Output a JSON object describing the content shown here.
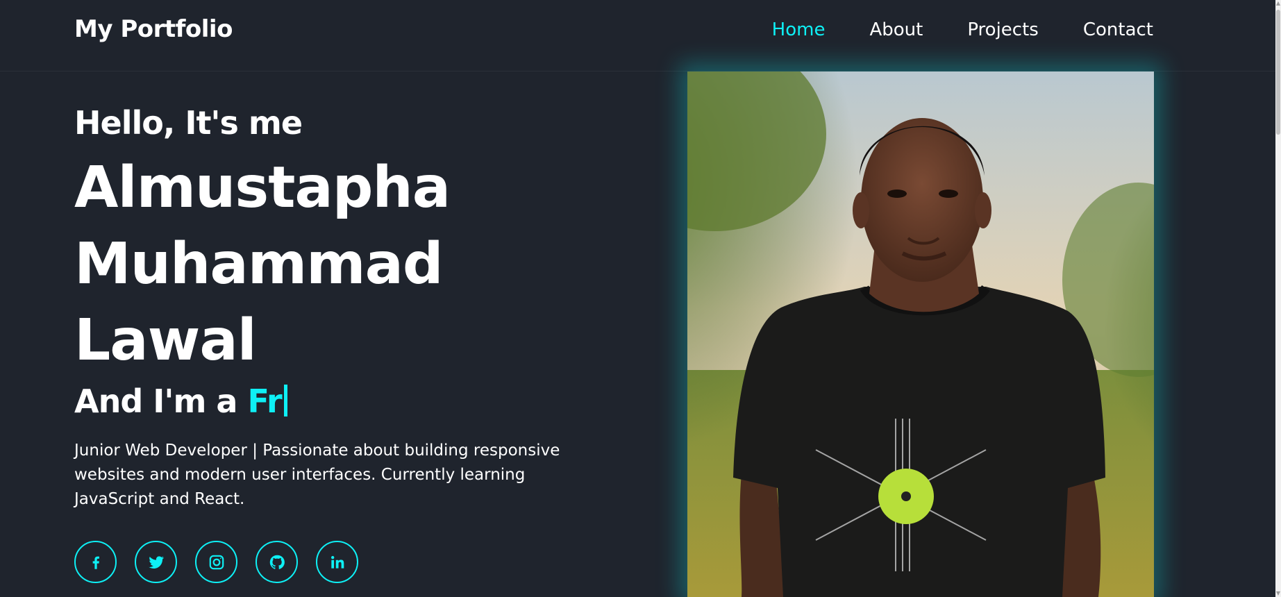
{
  "header": {
    "logo": "My Portfolio",
    "nav": [
      {
        "label": "Home",
        "active": true
      },
      {
        "label": "About",
        "active": false
      },
      {
        "label": "Projects",
        "active": false
      },
      {
        "label": "Contact",
        "active": false
      }
    ]
  },
  "hero": {
    "greeting": "Hello, It's me",
    "name_lines": [
      "Almustapha",
      "Muhammad",
      "Lawal"
    ],
    "role_prefix": "And I'm a ",
    "role_typed": "Fr",
    "description": "Junior Web Developer | Passionate about building responsive websites and modern user interfaces. Currently learning JavaScript and React."
  },
  "social": [
    {
      "icon": "facebook-icon"
    },
    {
      "icon": "twitter-icon"
    },
    {
      "icon": "instagram-icon"
    },
    {
      "icon": "github-icon"
    },
    {
      "icon": "linkedin-icon"
    }
  ],
  "colors": {
    "background": "#1f242d",
    "accent": "#0ef0f5",
    "text": "#ffffff"
  }
}
